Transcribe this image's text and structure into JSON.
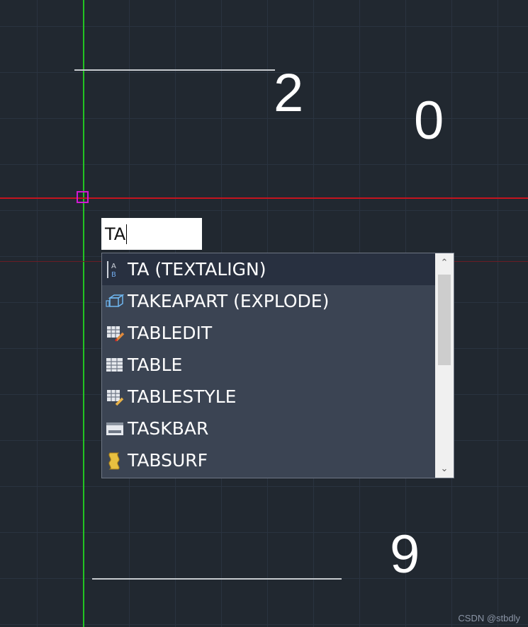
{
  "canvas": {
    "numbers": {
      "two": "2",
      "zero": "0",
      "nine": "9"
    },
    "colors": {
      "background": "#212830",
      "grid": "#2a3340",
      "y_axis": "#22c422",
      "x_axis": "#c4141e",
      "cursor": "#d11ad1",
      "text": "#ffffff"
    }
  },
  "command_input": {
    "value": "TA"
  },
  "autocomplete": {
    "items": [
      {
        "label": "TA (TEXTALIGN)",
        "icon": "text-align-icon",
        "selected": true
      },
      {
        "label": "TAKEAPART (EXPLODE)",
        "icon": "explode-cube-icon"
      },
      {
        "label": "TABLEDIT",
        "icon": "table-edit-icon"
      },
      {
        "label": "TABLE",
        "icon": "table-icon"
      },
      {
        "label": "TABLESTYLE",
        "icon": "table-style-icon"
      },
      {
        "label": "TASKBAR",
        "icon": "taskbar-icon"
      },
      {
        "label": "TABSURF",
        "icon": "tabsurf-icon"
      }
    ],
    "scroll": {
      "up": "⌃",
      "down": "⌄"
    }
  },
  "watermark": "CSDN @stbdly"
}
